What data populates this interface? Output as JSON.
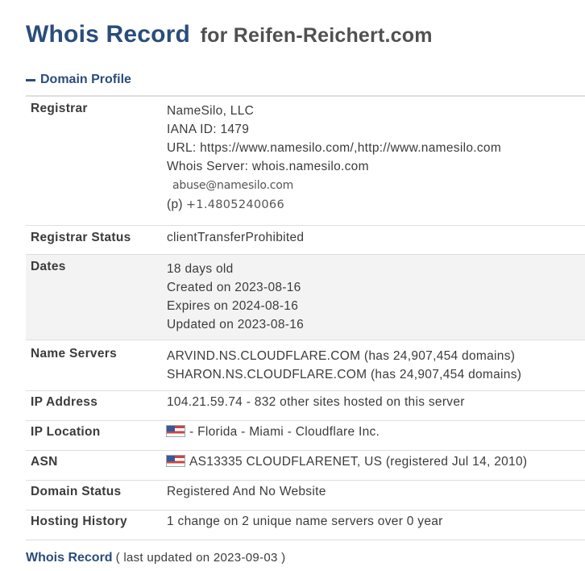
{
  "header": {
    "title": "Whois Record",
    "subtitle": "for Reifen-Reichert.com"
  },
  "section": {
    "label": "Domain Profile",
    "toggle_icon": "minus-icon"
  },
  "registrar": {
    "label": "Registrar",
    "name": "NameSilo, LLC",
    "iana": "IANA ID: 1479",
    "url": "URL: https://www.namesilo.com/,http://www.namesilo.com",
    "whois_server": "Whois Server: whois.namesilo.com",
    "abuse_email": "abuse@namesilo.com",
    "phone_prefix": "(p)",
    "phone": "+1.4805240066"
  },
  "registrar_status": {
    "label": "Registrar Status",
    "value": "clientTransferProhibited"
  },
  "dates": {
    "label": "Dates",
    "age": "18 days old",
    "created": "Created on 2023-08-16",
    "expires": "Expires on 2024-08-16",
    "updated": "Updated on 2023-08-16"
  },
  "name_servers": {
    "label": "Name Servers",
    "items": [
      "ARVIND.NS.CLOUDFLARE.COM (has 24,907,454 domains)",
      "SHARON.NS.CLOUDFLARE.COM (has 24,907,454 domains)"
    ]
  },
  "ip_address": {
    "label": "IP Address",
    "value": "104.21.59.74 - 832 other sites hosted on this server"
  },
  "ip_location": {
    "label": "IP Location",
    "value": "- Florida - Miami - Cloudflare Inc.",
    "flag_icon": "us-flag-icon"
  },
  "asn": {
    "label": "ASN",
    "value": "AS13335 CLOUDFLARENET, US (registered Jul 14, 2010)",
    "flag_icon": "us-flag-icon"
  },
  "domain_status": {
    "label": "Domain Status",
    "value": "Registered And No Website"
  },
  "hosting_history": {
    "label": "Hosting History",
    "value": "1 change on 2 unique name servers over 0 year"
  },
  "footer": {
    "link": "Whois Record",
    "note": "( last updated on 2023-09-03 )"
  },
  "colors": {
    "heading": "#2a4d7a",
    "alt_row_bg": "#f3f3f3",
    "border": "#dedede"
  }
}
